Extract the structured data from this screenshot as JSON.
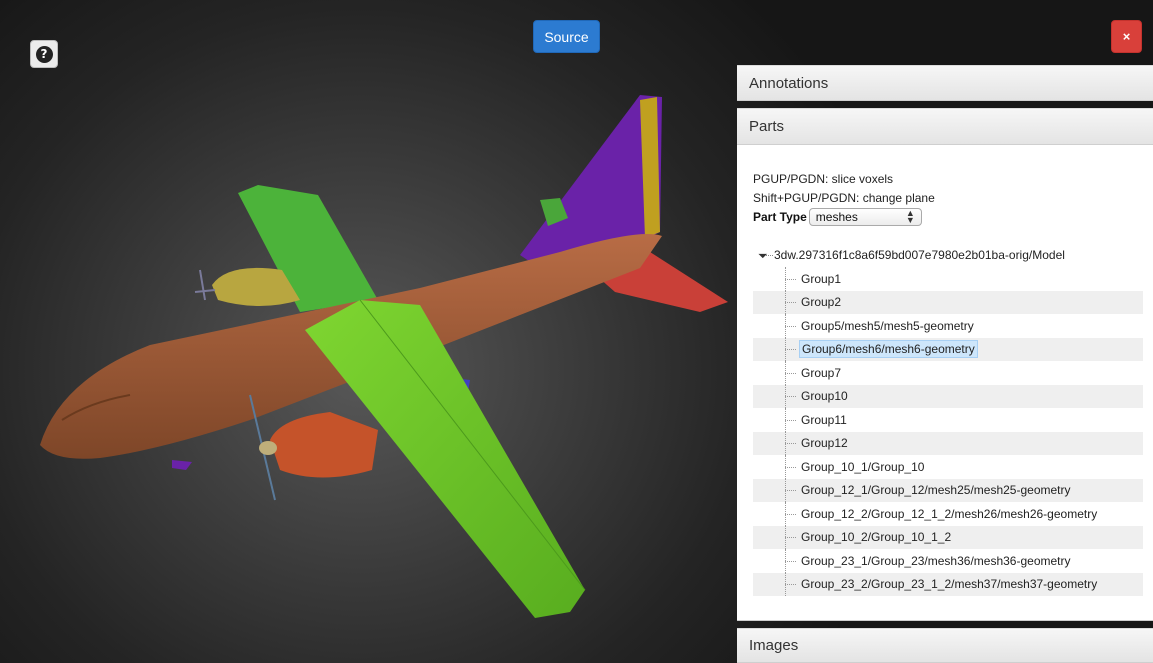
{
  "toolbar": {
    "help_icon": "question-circle-icon",
    "source_label": "Source",
    "close_label": "×",
    "accent": "#2c7bd1",
    "danger": "#d9403a"
  },
  "panels": {
    "annotations_title": "Annotations",
    "parts_title": "Parts",
    "images_title": "Images"
  },
  "parts": {
    "hint_slice": "PGUP/PGDN: slice voxels",
    "hint_plane": "Shift+PGUP/PGDN: change plane",
    "part_type_label": "Part Type",
    "part_type_value": "meshes",
    "tree_root": "3dw.297316f1c8a6f59bd007e7980e2b01ba-orig/Model",
    "tree_items": [
      "Group1",
      "Group2",
      "Group5/mesh5/mesh5-geometry",
      "Group6/mesh6/mesh6-geometry",
      "Group7",
      "Group10",
      "Group11",
      "Group12",
      "Group_10_1/Group_10",
      "Group_12_1/Group_12/mesh25/mesh25-geometry",
      "Group_12_2/Group_12_1_2/mesh26/mesh26-geometry",
      "Group_10_2/Group_10_1_2",
      "Group_23_1/Group_23/mesh36/mesh36-geometry",
      "Group_23_2/Group_23_1_2/mesh37/mesh37-geometry"
    ],
    "selected_item": "Group6/mesh6/mesh6-geometry"
  },
  "model_colors": {
    "fuselage": "#a5603a",
    "wing": "#6ec72a",
    "tail_fin": "#6a22a8",
    "stabilizer": "#c94038",
    "engine": "#b8a640"
  }
}
